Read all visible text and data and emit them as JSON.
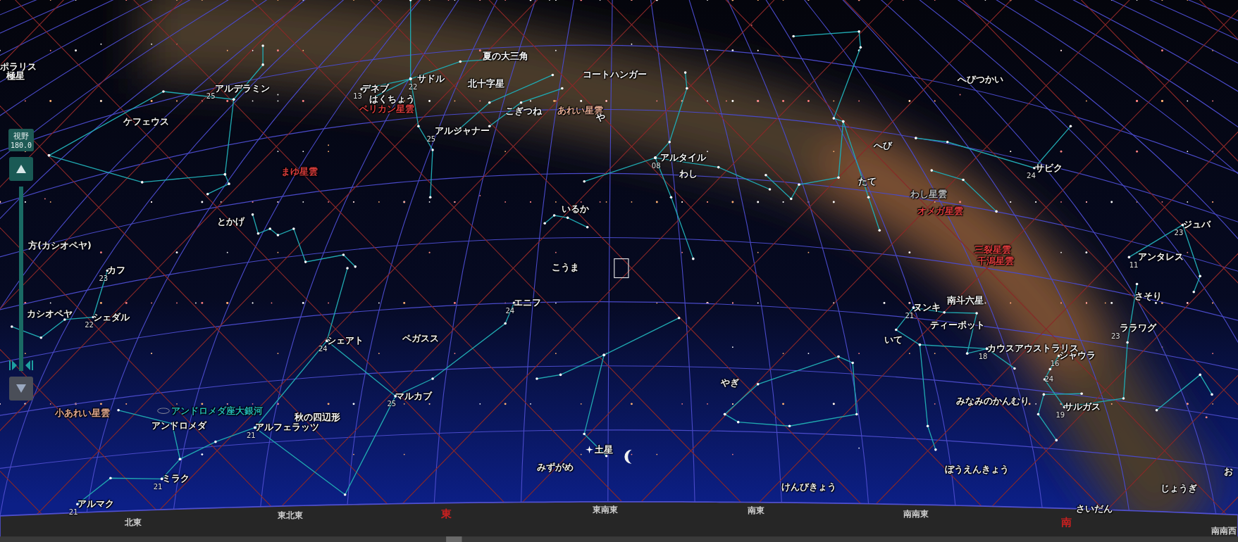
{
  "zoom": {
    "label": "視野",
    "value": "180.0",
    "level": 0
  },
  "buttons": [
    {
      "kind": "up",
      "disabled": false
    },
    {
      "kind": "down",
      "disabled": true
    }
  ],
  "labels": [
    {
      "kind": "star",
      "text": "ポラリス"
    },
    {
      "kind": "asterism",
      "text": "極星"
    },
    {
      "kind": "star",
      "text": "アルデラミン",
      "number": "25"
    },
    {
      "kind": "constellation",
      "text": "ケフェウス"
    },
    {
      "kind": "star",
      "text": "デネブ",
      "number": "13"
    },
    {
      "kind": "constellation",
      "text": "はくちょう"
    },
    {
      "kind": "nebula",
      "text": "ペリカン星雲",
      "color": "#d83c3c"
    },
    {
      "kind": "star",
      "text": "サドル",
      "number": "22"
    },
    {
      "kind": "asterism",
      "text": "夏の大三角"
    },
    {
      "kind": "asterism",
      "text": "北十字星"
    },
    {
      "kind": "asterism",
      "text": "コートハンガー"
    },
    {
      "kind": "constellation",
      "text": "こぎつね"
    },
    {
      "kind": "nebula",
      "text": "あれい星雲",
      "color": "#e0a890"
    },
    {
      "kind": "constellation",
      "text": "や"
    },
    {
      "kind": "star",
      "text": "アルジャナー",
      "number": "25"
    },
    {
      "kind": "nebula",
      "text": "まゆ星雲",
      "color": "#d83c3c"
    },
    {
      "kind": "star",
      "text": "アルタイル",
      "number": "08"
    },
    {
      "kind": "constellation",
      "text": "わし"
    },
    {
      "kind": "constellation",
      "text": "いるか"
    },
    {
      "kind": "constellation",
      "text": "とかげ"
    },
    {
      "kind": "constellation",
      "text": "方(カシオペヤ)"
    },
    {
      "kind": "star",
      "text": "カフ",
      "number": "23"
    },
    {
      "kind": "constellation",
      "text": "カシオペヤ"
    },
    {
      "kind": "star",
      "text": "シェダル",
      "number": "22"
    },
    {
      "kind": "constellation",
      "text": "こうま"
    },
    {
      "kind": "star",
      "text": "エニフ",
      "number": "24"
    },
    {
      "kind": "star",
      "text": "シェアト",
      "number": "24"
    },
    {
      "kind": "constellation",
      "text": "ペガスス"
    },
    {
      "kind": "star",
      "text": "マルカブ",
      "number": "25"
    },
    {
      "kind": "nebula",
      "text": "小あれい星雲",
      "color": "#e0a890"
    },
    {
      "kind": "galaxy",
      "text": "アンドロメダ座大銀河",
      "color": "#22b4b4"
    },
    {
      "kind": "constellation",
      "text": "アンドロメダ"
    },
    {
      "kind": "asterism",
      "text": "秋の四辺形"
    },
    {
      "kind": "star",
      "text": "アルフェラッツ",
      "number": "21"
    },
    {
      "kind": "star",
      "text": "ミラク",
      "number": "21"
    },
    {
      "kind": "star",
      "text": "アルマク",
      "number": "21"
    },
    {
      "kind": "planet",
      "text": "土星"
    },
    {
      "kind": "constellation",
      "text": "みずがめ"
    },
    {
      "kind": "constellation",
      "text": "やぎ"
    },
    {
      "kind": "constellation",
      "text": "けんびきょう"
    },
    {
      "kind": "constellation",
      "text": "へびつかい"
    },
    {
      "kind": "constellation",
      "text": "へび"
    },
    {
      "kind": "star",
      "text": "サビク",
      "number": "24"
    },
    {
      "kind": "constellation",
      "text": "たて"
    },
    {
      "kind": "nebula",
      "text": "わし星雲",
      "color": "#b8b8b8"
    },
    {
      "kind": "nebula",
      "text": "オメガ星雲",
      "color": "#e03c3c"
    },
    {
      "kind": "nebula",
      "text": "三裂星雲",
      "color": "#e03c3c"
    },
    {
      "kind": "nebula",
      "text": "干潟星雲",
      "color": "#e03c3c"
    },
    {
      "kind": "star",
      "text": "ジュバ",
      "number": "23"
    },
    {
      "kind": "star",
      "text": "アンタレス",
      "number": "11"
    },
    {
      "kind": "constellation",
      "text": "さそり"
    },
    {
      "kind": "asterism",
      "text": "南斗六星"
    },
    {
      "kind": "star",
      "text": "ヌンキ",
      "number": "21"
    },
    {
      "kind": "asterism",
      "text": "ティーポット"
    },
    {
      "kind": "constellation",
      "text": "いて"
    },
    {
      "kind": "star",
      "text": "ララワグ",
      "number": "23"
    },
    {
      "kind": "star",
      "text": "カウスアウストラリス",
      "number": "18"
    },
    {
      "kind": "star",
      "text": "シャウラ",
      "number": "16"
    },
    {
      "kind": "number",
      "number": "24"
    },
    {
      "kind": "constellation",
      "text": "みなみのかんむり"
    },
    {
      "kind": "star",
      "text": "サルガス",
      "number": "19"
    },
    {
      "kind": "constellation",
      "text": "ぼうえんきょう"
    },
    {
      "kind": "constellation",
      "text": "じょうぎ"
    },
    {
      "kind": "constellation",
      "text": "さいだん"
    },
    {
      "kind": "constellation",
      "text": "お"
    }
  ],
  "horizon": [
    {
      "text": "北東",
      "cardinal": false
    },
    {
      "text": "東北東",
      "cardinal": false
    },
    {
      "text": "東",
      "cardinal": true
    },
    {
      "text": "東南東",
      "cardinal": false
    },
    {
      "text": "南東",
      "cardinal": false
    },
    {
      "text": "南南東",
      "cardinal": false
    },
    {
      "text": "南",
      "cardinal": true
    },
    {
      "text": "南南西",
      "cardinal": false
    }
  ]
}
